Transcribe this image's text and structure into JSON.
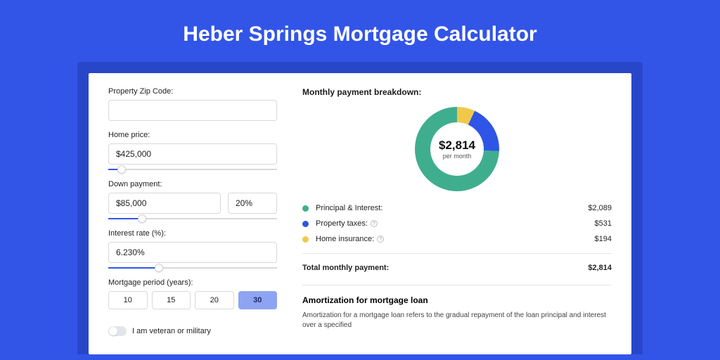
{
  "title": "Heber Springs Mortgage Calculator",
  "colors": {
    "principal": "#3fae8f",
    "taxes": "#2f55e6",
    "insurance": "#f0c94b"
  },
  "form": {
    "zip": {
      "label": "Property Zip Code:",
      "value": ""
    },
    "price": {
      "label": "Home price:",
      "value": "$425,000",
      "sliderPct": 8
    },
    "down": {
      "label": "Down payment:",
      "value": "$85,000",
      "pct": "20%",
      "sliderPct": 20
    },
    "rate": {
      "label": "Interest rate (%):",
      "value": "6.230%",
      "sliderPct": 30
    },
    "period": {
      "label": "Mortgage period (years):",
      "options": [
        "10",
        "15",
        "20",
        "30"
      ],
      "selected": "30"
    },
    "veteran": {
      "label": "I am veteran or military",
      "checked": false
    }
  },
  "breakdown": {
    "title": "Monthly payment breakdown:",
    "centerValue": "$2,814",
    "centerSub": "per month",
    "items": {
      "principal": {
        "label": "Principal & Interest:",
        "value": "$2,089"
      },
      "taxes": {
        "label": "Property taxes:",
        "value": "$531"
      },
      "insurance": {
        "label": "Home insurance:",
        "value": "$194"
      }
    },
    "total": {
      "label": "Total monthly payment:",
      "value": "$2,814"
    }
  },
  "amort": {
    "title": "Amortization for mortgage loan",
    "text": "Amortization for a mortgage loan refers to the gradual repayment of the loan principal and interest over a specified"
  },
  "chart_data": {
    "type": "pie",
    "title": "Monthly payment breakdown",
    "series": [
      {
        "name": "Principal & Interest",
        "value": 2089,
        "color": "#3fae8f"
      },
      {
        "name": "Property taxes",
        "value": 531,
        "color": "#2f55e6"
      },
      {
        "name": "Home insurance",
        "value": 194,
        "color": "#f0c94b"
      }
    ],
    "total": 2814,
    "center_label": "$2,814 per month"
  }
}
